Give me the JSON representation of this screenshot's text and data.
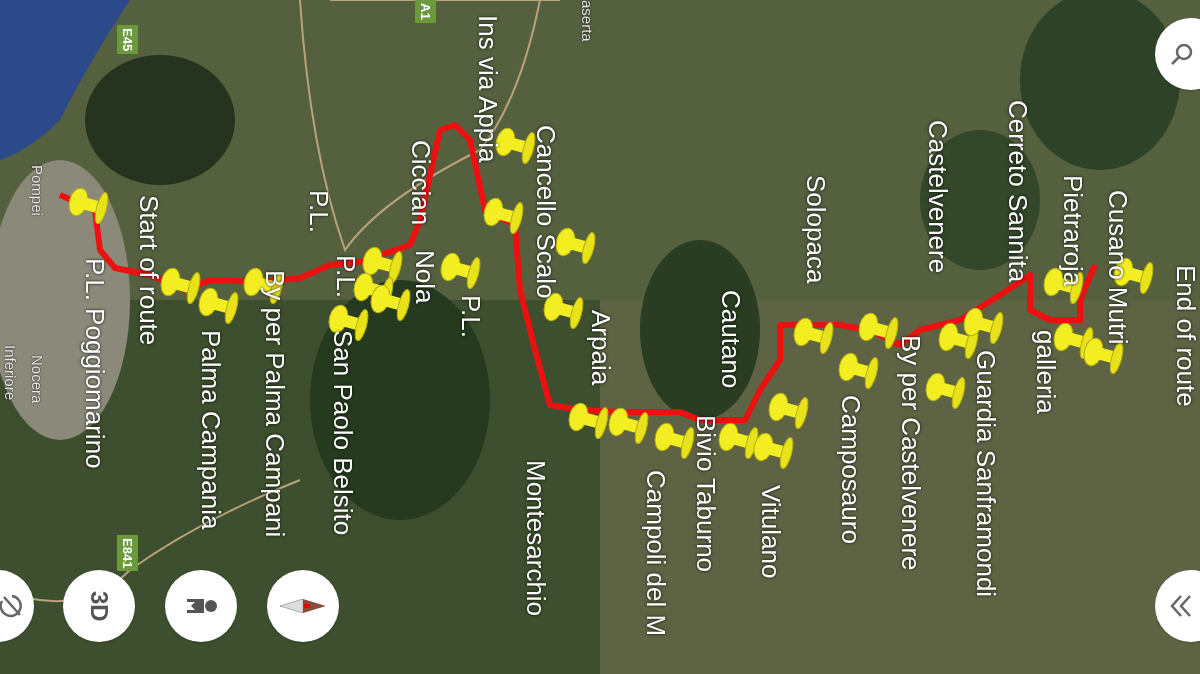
{
  "map_labels": [
    {
      "text": "Pompei",
      "kind": "area"
    },
    {
      "text": "Nocera",
      "kind": "area"
    },
    {
      "text": "Inferiore",
      "kind": "area"
    },
    {
      "text": "P.L. Poggiomarino",
      "kind": "place"
    },
    {
      "text": "Start of route",
      "kind": "place"
    },
    {
      "text": "Palma Campania",
      "kind": "place"
    },
    {
      "text": "By per Palma Campani",
      "kind": "place"
    },
    {
      "text": "P.L.",
      "kind": "place"
    },
    {
      "text": "P.L.",
      "kind": "place"
    },
    {
      "text": "San Paolo Belsito",
      "kind": "place"
    },
    {
      "text": "Ciccian",
      "kind": "place"
    },
    {
      "text": "Nola",
      "kind": "place"
    },
    {
      "text": "P.L.",
      "kind": "place"
    },
    {
      "text": "Ins via Appia",
      "kind": "place"
    },
    {
      "text": "aserta",
      "kind": "area"
    },
    {
      "text": "Cancello Scalo",
      "kind": "place"
    },
    {
      "text": "Arpaia",
      "kind": "place"
    },
    {
      "text": "Montesarchio",
      "kind": "place"
    },
    {
      "text": "Cautano",
      "kind": "place"
    },
    {
      "text": "Campoli del M",
      "kind": "place"
    },
    {
      "text": "Bivio Taburno",
      "kind": "place"
    },
    {
      "text": "Vitulano",
      "kind": "place"
    },
    {
      "text": "Solopaca",
      "kind": "place"
    },
    {
      "text": "Camposauro",
      "kind": "place"
    },
    {
      "text": "Castelvenere",
      "kind": "place"
    },
    {
      "text": "By per Castelvenere",
      "kind": "place"
    },
    {
      "text": "Cerreto Sannita",
      "kind": "place"
    },
    {
      "text": "Guardia Sanframondi",
      "kind": "place"
    },
    {
      "text": "Pietraroja",
      "kind": "place"
    },
    {
      "text": "galleria",
      "kind": "place"
    },
    {
      "text": "Cusano Mutri",
      "kind": "place"
    },
    {
      "text": "End of route",
      "kind": "place"
    }
  ],
  "road_shields": [
    "E45",
    "A1",
    "E841"
  ],
  "controls": {
    "view_3d_label": "3D"
  }
}
